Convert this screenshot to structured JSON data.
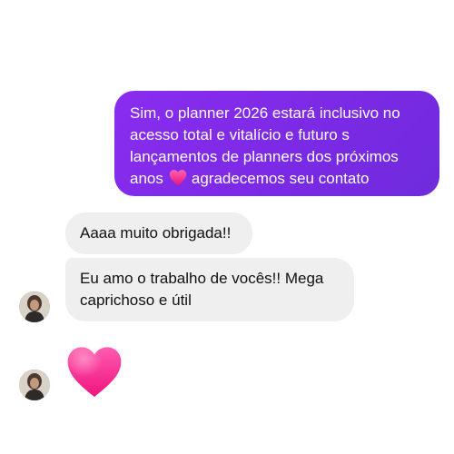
{
  "conversation": {
    "outgoing": {
      "lines": [
        "Sim, o planner 2026 estará inclusivo no",
        "acesso total e vitalício e futuro s",
        "lançamentos de planners dos próximos"
      ],
      "last_line_before_emoji": "anos",
      "last_line_after_emoji": "agradecemos seu contato",
      "emoji": "pink-heart-icon"
    },
    "incoming": [
      {
        "text": "Aaaa muito obrigada!!"
      },
      {
        "lines": [
          "Eu amo o trabalho de vocês!! Mega",
          "caprichoso e útil"
        ]
      }
    ],
    "reaction_emoji": "pink-heart-icon"
  },
  "colors": {
    "outgoing_bubble": "#7d2be6",
    "incoming_bubble": "#efefef",
    "heart": "#ff2f92"
  }
}
